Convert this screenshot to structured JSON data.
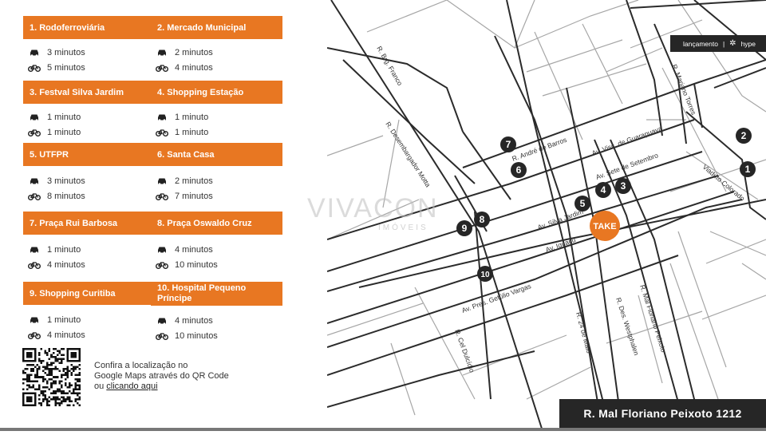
{
  "cards": [
    {
      "title": "1. Rodoferroviária",
      "car": "3 minutos",
      "bike": "5 minutos"
    },
    {
      "title": "2. Mercado Municipal",
      "car": "2 minutos",
      "bike": "4 minutos"
    },
    {
      "title": "3. Festval Silva Jardim",
      "car": "1 minuto",
      "bike": "1 minuto"
    },
    {
      "title": "4. Shopping Estação",
      "car": "1 minuto",
      "bike": "1 minuto"
    },
    {
      "title": "5. UTFPR",
      "car": "3 minutos",
      "bike": "8 minutos"
    },
    {
      "title": "6. Santa Casa",
      "car": "2 minutos",
      "bike": "7 minutos"
    },
    {
      "title": "7. Praça Rui Barbosa",
      "car": "1 minuto",
      "bike": "4 minutos"
    },
    {
      "title": "8. Praça Oswaldo Cruz",
      "car": "4 minutos",
      "bike": "10 minutos"
    },
    {
      "title": "9. Shopping Curitiba",
      "car": "1 minuto",
      "bike": "4 minutos"
    },
    {
      "title": "10. Hospital Pequeno Príncipe",
      "car": "4 minutos",
      "bike": "10 minutos"
    }
  ],
  "qr": {
    "line1": "Confira a localização no",
    "line2": "Google Maps através do QR Code",
    "line3_prefix": "ou ",
    "link": "clicando aqui"
  },
  "header": {
    "launch": "lançamento",
    "sep": "|",
    "brand": "hype"
  },
  "address": "R. Mal Floriano Peixoto 1212",
  "watermark": {
    "main": "VIVACON",
    "sub": "IMÓVEIS"
  },
  "map_marker": "TAKE",
  "pins": [
    "1",
    "2",
    "3",
    "4",
    "5",
    "6",
    "7",
    "8",
    "9",
    "10"
  ],
  "streets": {
    "brig_franco": "R. Brg. Franco",
    "desemb_motta": "R. Desembargador Motta",
    "andre_barros": "R. André de Barros",
    "visc_guarapuava": "Av. Visc. de Guarapuava",
    "sete_setembro": "Av. Sete de Setembro",
    "silva_jardim": "Av. Silva Jardim",
    "iguacu": "Av. Iguaçu",
    "getulio_vargas": "Av. Pres. Getúlio Vargas",
    "cel_dulcidio": "R. Cel Dulcídio",
    "vinte_quatro_maio": "R. 24 de Maio",
    "des_westphalen": "R. Des. Westphalen",
    "mal_floriano": "R. Mal Floriano Peixoto",
    "mariano_torres": "R. Mariano Torres",
    "viaduto_colorado": "Viaduto Colorado"
  },
  "colors": {
    "accent": "#e87722",
    "dark": "#262626",
    "road": "#2b2b2b",
    "road_light": "#9a9a9a"
  }
}
